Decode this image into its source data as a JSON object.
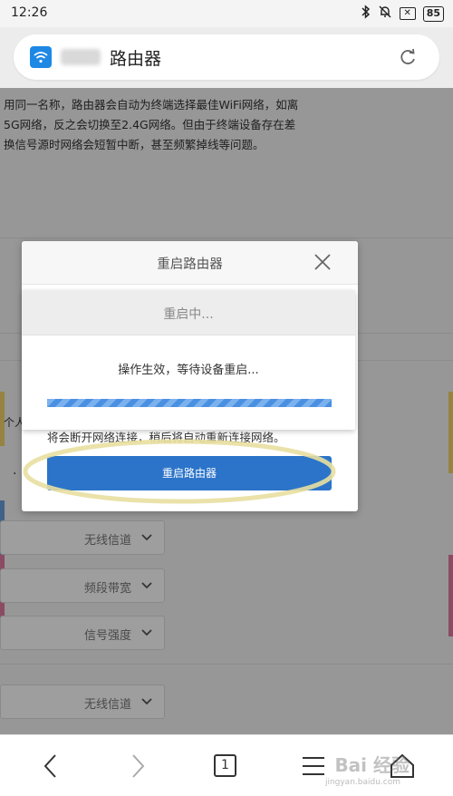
{
  "status_bar": {
    "time": "12:26",
    "battery": "85",
    "icons": [
      "bluetooth-icon",
      "bell-off-icon",
      "mute-box-icon",
      "battery-icon"
    ]
  },
  "address_bar": {
    "title": "路由器",
    "site_icon": "wifi-icon",
    "reload_icon": "reload-icon"
  },
  "page": {
    "paragraph_lines": [
      "用同一名称，路由器会自动为终端选择最佳WiFi网络，如离",
      "5G网络，反之会切换至2.4G网络。但由于终端设备存在差",
      "换信号源时网络会短暂中断，甚至频繁掉线等问题。"
    ],
    "fragment_left": "个人",
    "selects": [
      "无线信道",
      "频段带宽",
      "信号强度",
      "无线信道"
    ]
  },
  "dialog": {
    "title": "重启路由器",
    "warning_text": "将会断开网络连接，稍后将自动重新连接网络。",
    "reboot_button": "重启路由器"
  },
  "progress_dialog": {
    "title": "重启中...",
    "message": "操作生效，等待设备重启...",
    "progress": 1.0
  },
  "bottom_nav": {
    "tab_count": "1",
    "items": [
      "back-icon",
      "forward-icon",
      "tabs-icon",
      "menu-icon",
      "home-icon"
    ]
  },
  "watermark": {
    "text": "Bai 经验",
    "sub": "jingyan.baidu.com"
  },
  "colors": {
    "accent": "#2b74c9",
    "progress": "#4a90e2",
    "highlight": "#e8dfa0"
  }
}
